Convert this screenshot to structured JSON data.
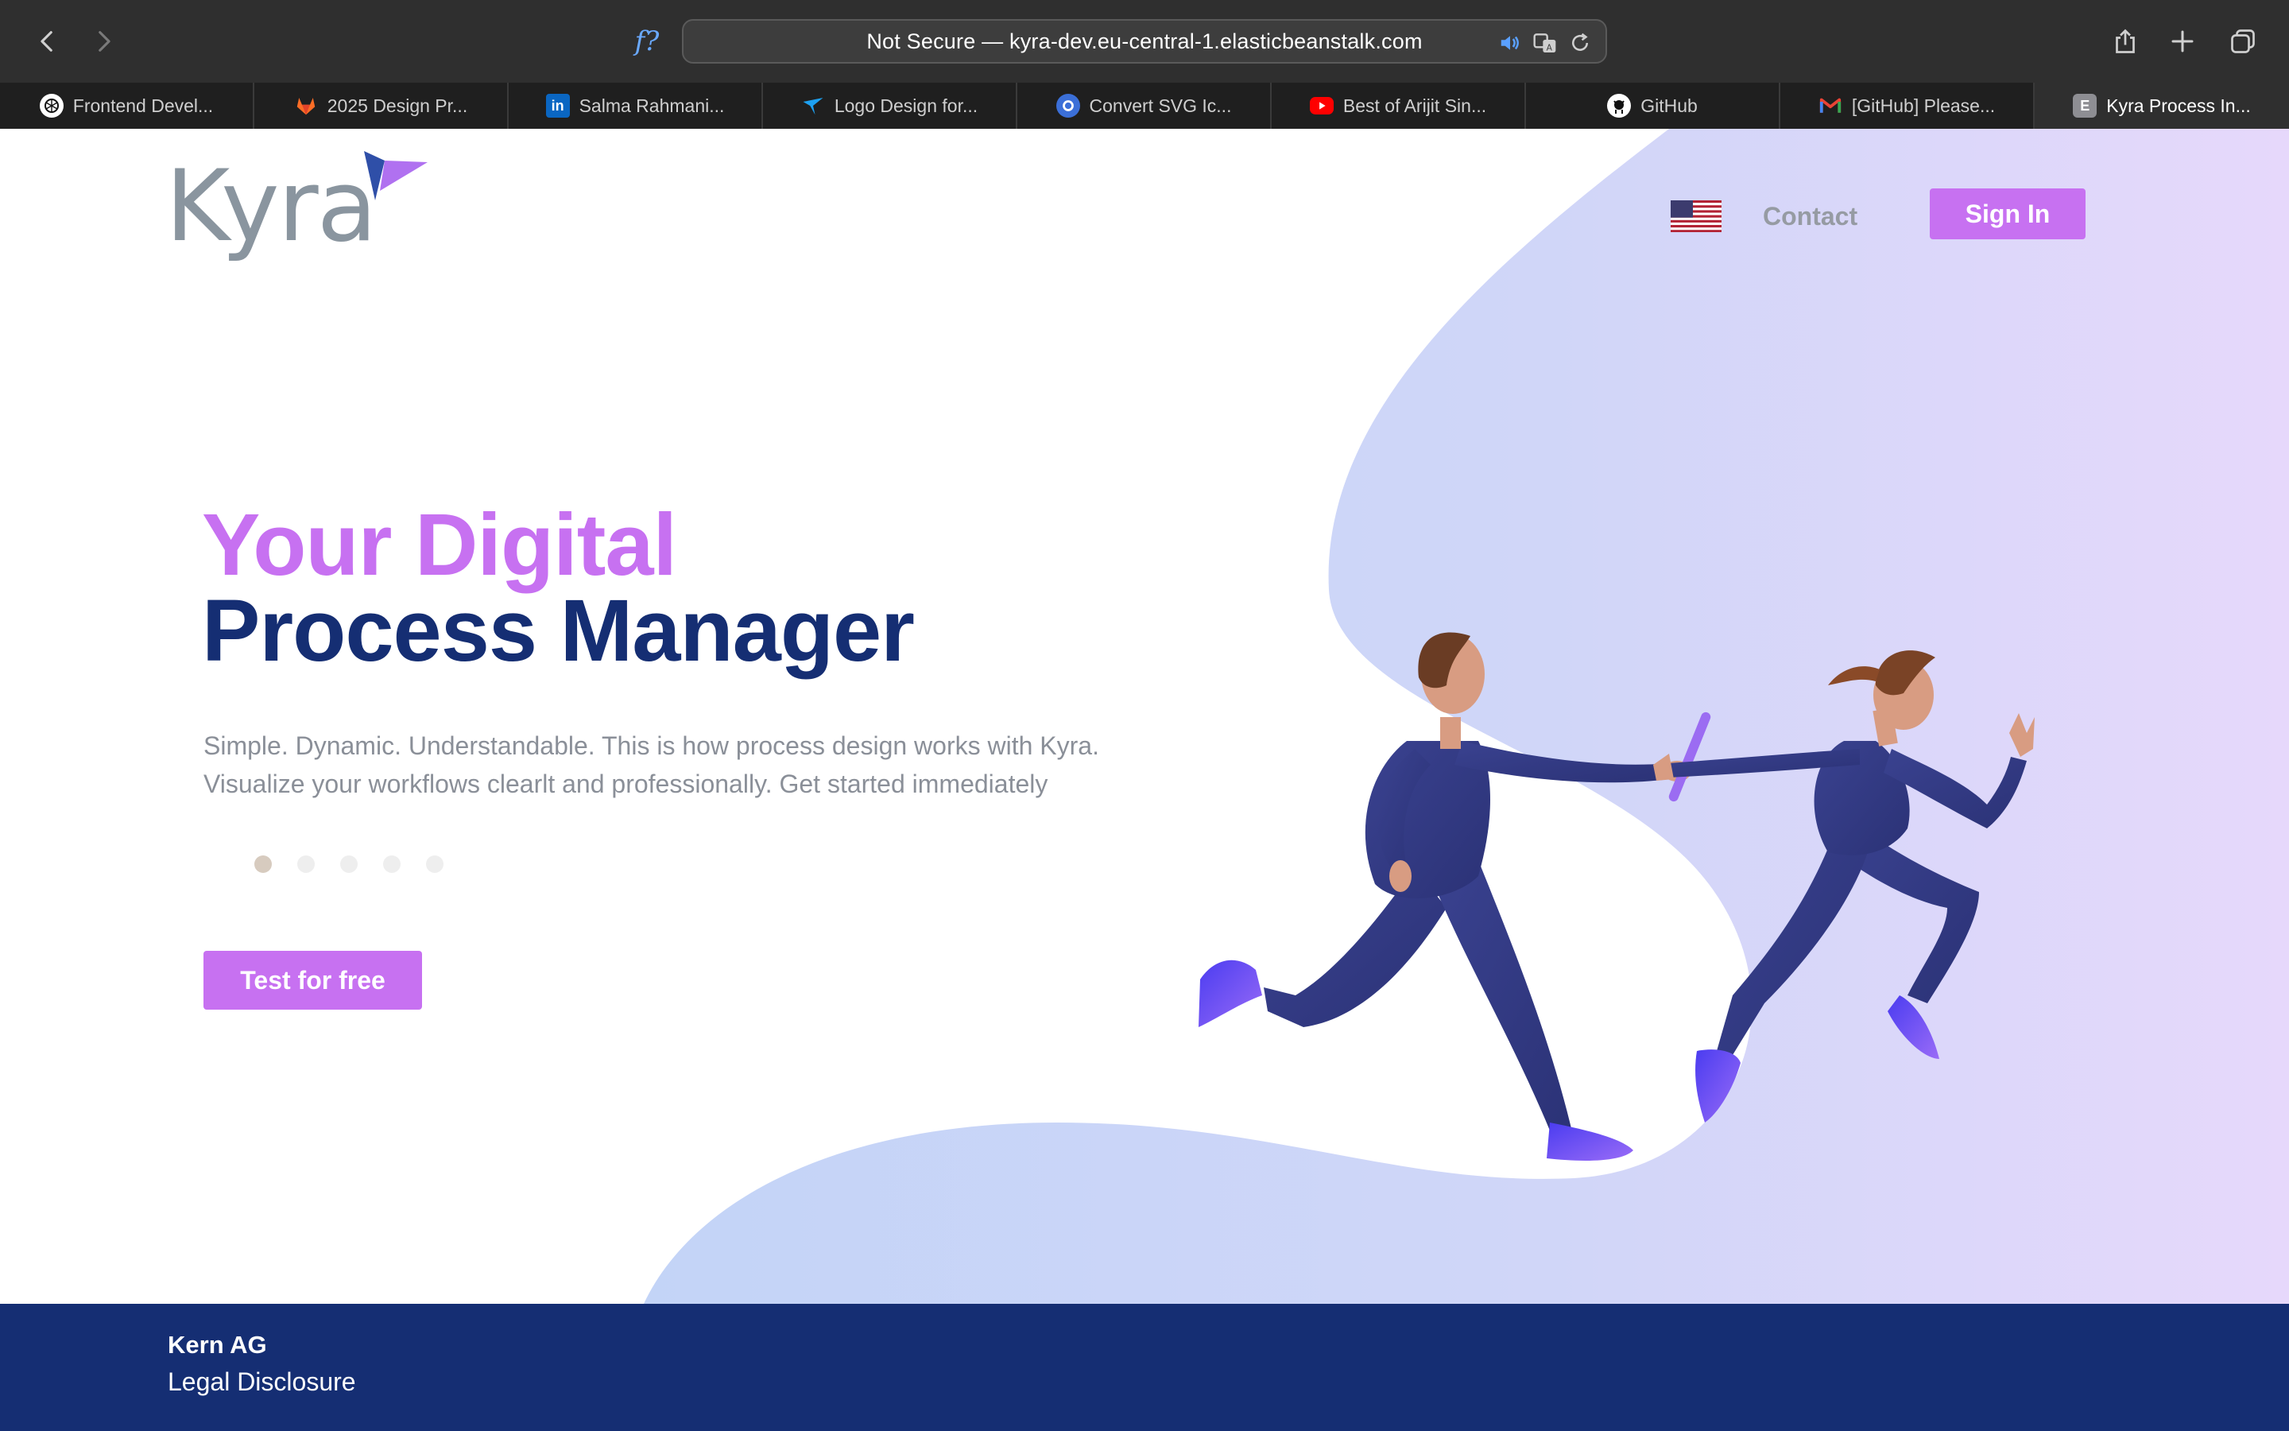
{
  "browser": {
    "url": "Not Secure — kyra-dev.eu-central-1.elasticbeanstalk.com",
    "reader_glyph": "f?",
    "tabs": [
      {
        "label": "Frontend Devel...",
        "icon": "openai-icon",
        "color": "#ffffff"
      },
      {
        "label": "2025 Design Pr...",
        "icon": "gitlab-icon",
        "color": "#fc6d26"
      },
      {
        "label": "Salma Rahmani...",
        "icon": "linkedin-icon",
        "color": "#0a66c2"
      },
      {
        "label": "Logo Design for...",
        "icon": "bird-icon",
        "color": "#1da1f2"
      },
      {
        "label": "Convert SVG Ic...",
        "icon": "convert-icon",
        "color": "#3b6fd8"
      },
      {
        "label": "Best of Arijit Sin...",
        "icon": "youtube-icon",
        "color": "#ff0000"
      },
      {
        "label": "GitHub",
        "icon": "github-icon",
        "color": "#ffffff"
      },
      {
        "label": "[GitHub] Please...",
        "icon": "gmail-icon",
        "color": "#ea4335"
      },
      {
        "label": "Kyra Process In...",
        "icon": "letter-e-icon",
        "color": "#8e8e93",
        "letter": "E",
        "active": true
      }
    ]
  },
  "header": {
    "logo_text": "Kyra",
    "contact_label": "Contact",
    "signin_label": "Sign In",
    "language": "en-US"
  },
  "hero": {
    "title_line1": "Your Digital",
    "title_line2": "Process Manager",
    "subtitle_line1": "Simple. Dynamic. Understandable. This is how process design works with Kyra.",
    "subtitle_line2": "Visualize your workflows clearlt and professionally. Get started immediately",
    "carousel_count": 5,
    "carousel_active": 1,
    "cta_label": "Test for free"
  },
  "footer": {
    "company": "Kern AG",
    "legal_link": "Legal Disclosure"
  },
  "colors": {
    "brand_purple": "#c771f1",
    "brand_navy": "#152e73",
    "chrome_dark": "#2f2f2f",
    "tab_bar": "#1f1f1f"
  }
}
